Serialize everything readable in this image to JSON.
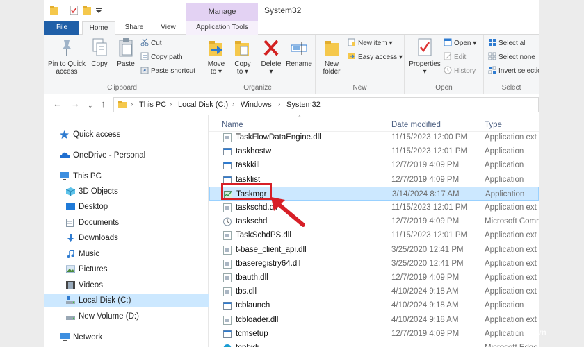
{
  "window": {
    "title": "System32",
    "manage_label": "Manage"
  },
  "tabs": {
    "file": "File",
    "home": "Home",
    "share": "Share",
    "view": "View",
    "app_tools": "Application Tools"
  },
  "ribbon": {
    "clipboard": {
      "label": "Clipboard",
      "pin_line1": "Pin to Quick",
      "pin_line2": "access",
      "copy": "Copy",
      "paste": "Paste",
      "cut": "Cut",
      "copy_path": "Copy path",
      "paste_shortcut": "Paste shortcut"
    },
    "organize": {
      "label": "Organize",
      "move_line1": "Move",
      "move_line2": "to",
      "copy_line1": "Copy",
      "copy_line2": "to",
      "delete": "Delete",
      "rename": "Rename"
    },
    "new": {
      "label": "New",
      "new_folder_line1": "New",
      "new_folder_line2": "folder",
      "new_item": "New item",
      "easy_access": "Easy access"
    },
    "open": {
      "label": "Open",
      "properties": "Properties",
      "open": "Open",
      "edit": "Edit",
      "history": "History"
    },
    "select": {
      "label": "Select",
      "select_all": "Select all",
      "select_none": "Select none",
      "invert_selection": "Invert selection"
    }
  },
  "address": {
    "crumbs": [
      "This PC",
      "Local Disk (C:)",
      "Windows",
      "System32"
    ]
  },
  "nav": {
    "items": [
      {
        "label": "Quick access",
        "icon": "star-icon"
      },
      {
        "label": "OneDrive - Personal",
        "icon": "cloud-icon"
      },
      {
        "label": "This PC",
        "icon": "computer-icon"
      },
      {
        "label": "3D Objects",
        "icon": "cube-icon"
      },
      {
        "label": "Desktop",
        "icon": "desktop-icon"
      },
      {
        "label": "Documents",
        "icon": "document-icon"
      },
      {
        "label": "Downloads",
        "icon": "download-icon"
      },
      {
        "label": "Music",
        "icon": "music-icon"
      },
      {
        "label": "Pictures",
        "icon": "picture-icon"
      },
      {
        "label": "Videos",
        "icon": "video-icon"
      },
      {
        "label": "Local Disk (C:)",
        "icon": "drive-icon"
      },
      {
        "label": "New Volume (D:)",
        "icon": "drive-icon"
      },
      {
        "label": "Network",
        "icon": "network-icon"
      }
    ]
  },
  "columns": {
    "name": "Name",
    "date": "Date modified",
    "type": "Type"
  },
  "files": [
    {
      "name": "TaskFlowDataEngine.dll",
      "date": "11/15/2023 12:00 PM",
      "type": "Application ext"
    },
    {
      "name": "taskhostw",
      "date": "11/15/2023 12:01 PM",
      "type": "Application"
    },
    {
      "name": "taskkill",
      "date": "12/7/2019 4:09 PM",
      "type": "Application"
    },
    {
      "name": "tasklist",
      "date": "12/7/2019 4:09 PM",
      "type": "Application"
    },
    {
      "name": "Taskmgr",
      "date": "3/14/2024 8:17 AM",
      "type": "Application"
    },
    {
      "name": "taskschd.dll",
      "date": "11/15/2023 12:01 PM",
      "type": "Application ext"
    },
    {
      "name": "taskschd",
      "date": "12/7/2019 4:09 PM",
      "type": "Microsoft Comm"
    },
    {
      "name": "TaskSchdPS.dll",
      "date": "11/15/2023 12:01 PM",
      "type": "Application ext"
    },
    {
      "name": "t-base_client_api.dll",
      "date": "3/25/2020 12:41 PM",
      "type": "Application ext"
    },
    {
      "name": "tbaseregistry64.dll",
      "date": "3/25/2020 12:41 PM",
      "type": "Application ext"
    },
    {
      "name": "tbauth.dll",
      "date": "12/7/2019 4:09 PM",
      "type": "Application ext"
    },
    {
      "name": "tbs.dll",
      "date": "4/10/2024 9:18 AM",
      "type": "Application ext"
    },
    {
      "name": "tcblaunch",
      "date": "4/10/2024 9:18 AM",
      "type": "Application"
    },
    {
      "name": "tcbloader.dll",
      "date": "4/10/2024 9:18 AM",
      "type": "Application ext"
    },
    {
      "name": "tcmsetup",
      "date": "12/7/2019 4:09 PM",
      "type": "Application"
    },
    {
      "name": "tcpbidi",
      "date": "",
      "type": "Microsoft Edge"
    }
  ],
  "watermark": "thien.vn",
  "colors": {
    "accent": "#1f5fa8",
    "selection": "#cce8ff",
    "manage": "#e3d2f3",
    "annotation": "#d71f27"
  }
}
